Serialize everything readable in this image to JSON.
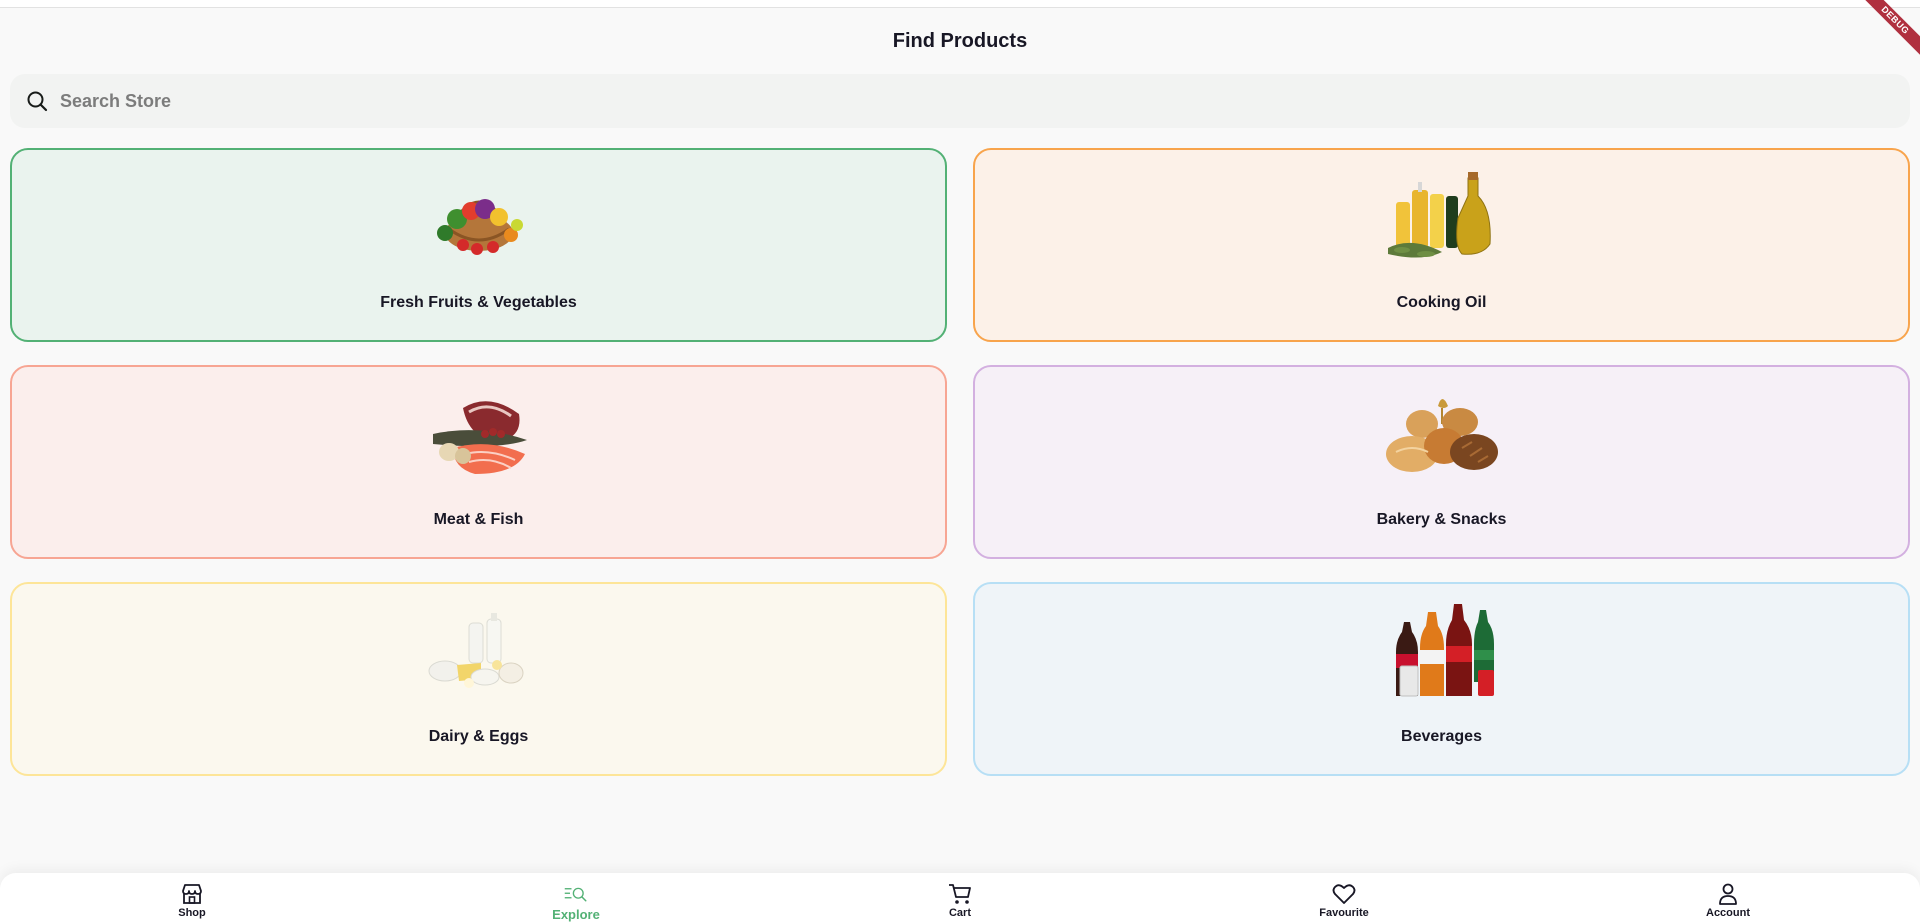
{
  "header": {
    "title": "Find Products",
    "debug_banner": "DEBUG"
  },
  "search": {
    "placeholder": "Search Store",
    "value": "",
    "icon": "search-icon"
  },
  "categories": [
    {
      "label": "Fresh Fruits & Vegetables",
      "icon": "vegetable-basket-icon",
      "bg": "#eaf3ee",
      "border": "#53b175"
    },
    {
      "label": "Cooking Oil",
      "icon": "oil-bottles-icon",
      "bg": "#fcf1e8",
      "border": "#f8a44c"
    },
    {
      "label": "Meat & Fish",
      "icon": "meat-fish-icon",
      "bg": "#fbeeec",
      "border": "#f7a593"
    },
    {
      "label": "Bakery & Snacks",
      "icon": "bread-icon",
      "bg": "#f6f0f7",
      "border": "#d3b0e0"
    },
    {
      "label": "Dairy & Eggs",
      "icon": "dairy-icon",
      "bg": "#fbf8ee",
      "border": "#fde598"
    },
    {
      "label": "Beverages",
      "icon": "soda-bottles-icon",
      "bg": "#eff4f8",
      "border": "#b7dff5"
    }
  ],
  "bottom_nav": {
    "active": "Explore",
    "active_color": "#53b175",
    "items": [
      {
        "label": "Shop",
        "icon": "store-icon"
      },
      {
        "label": "Explore",
        "icon": "explore-search-icon"
      },
      {
        "label": "Cart",
        "icon": "cart-icon"
      },
      {
        "label": "Favourite",
        "icon": "heart-icon"
      },
      {
        "label": "Account",
        "icon": "user-icon"
      }
    ]
  }
}
